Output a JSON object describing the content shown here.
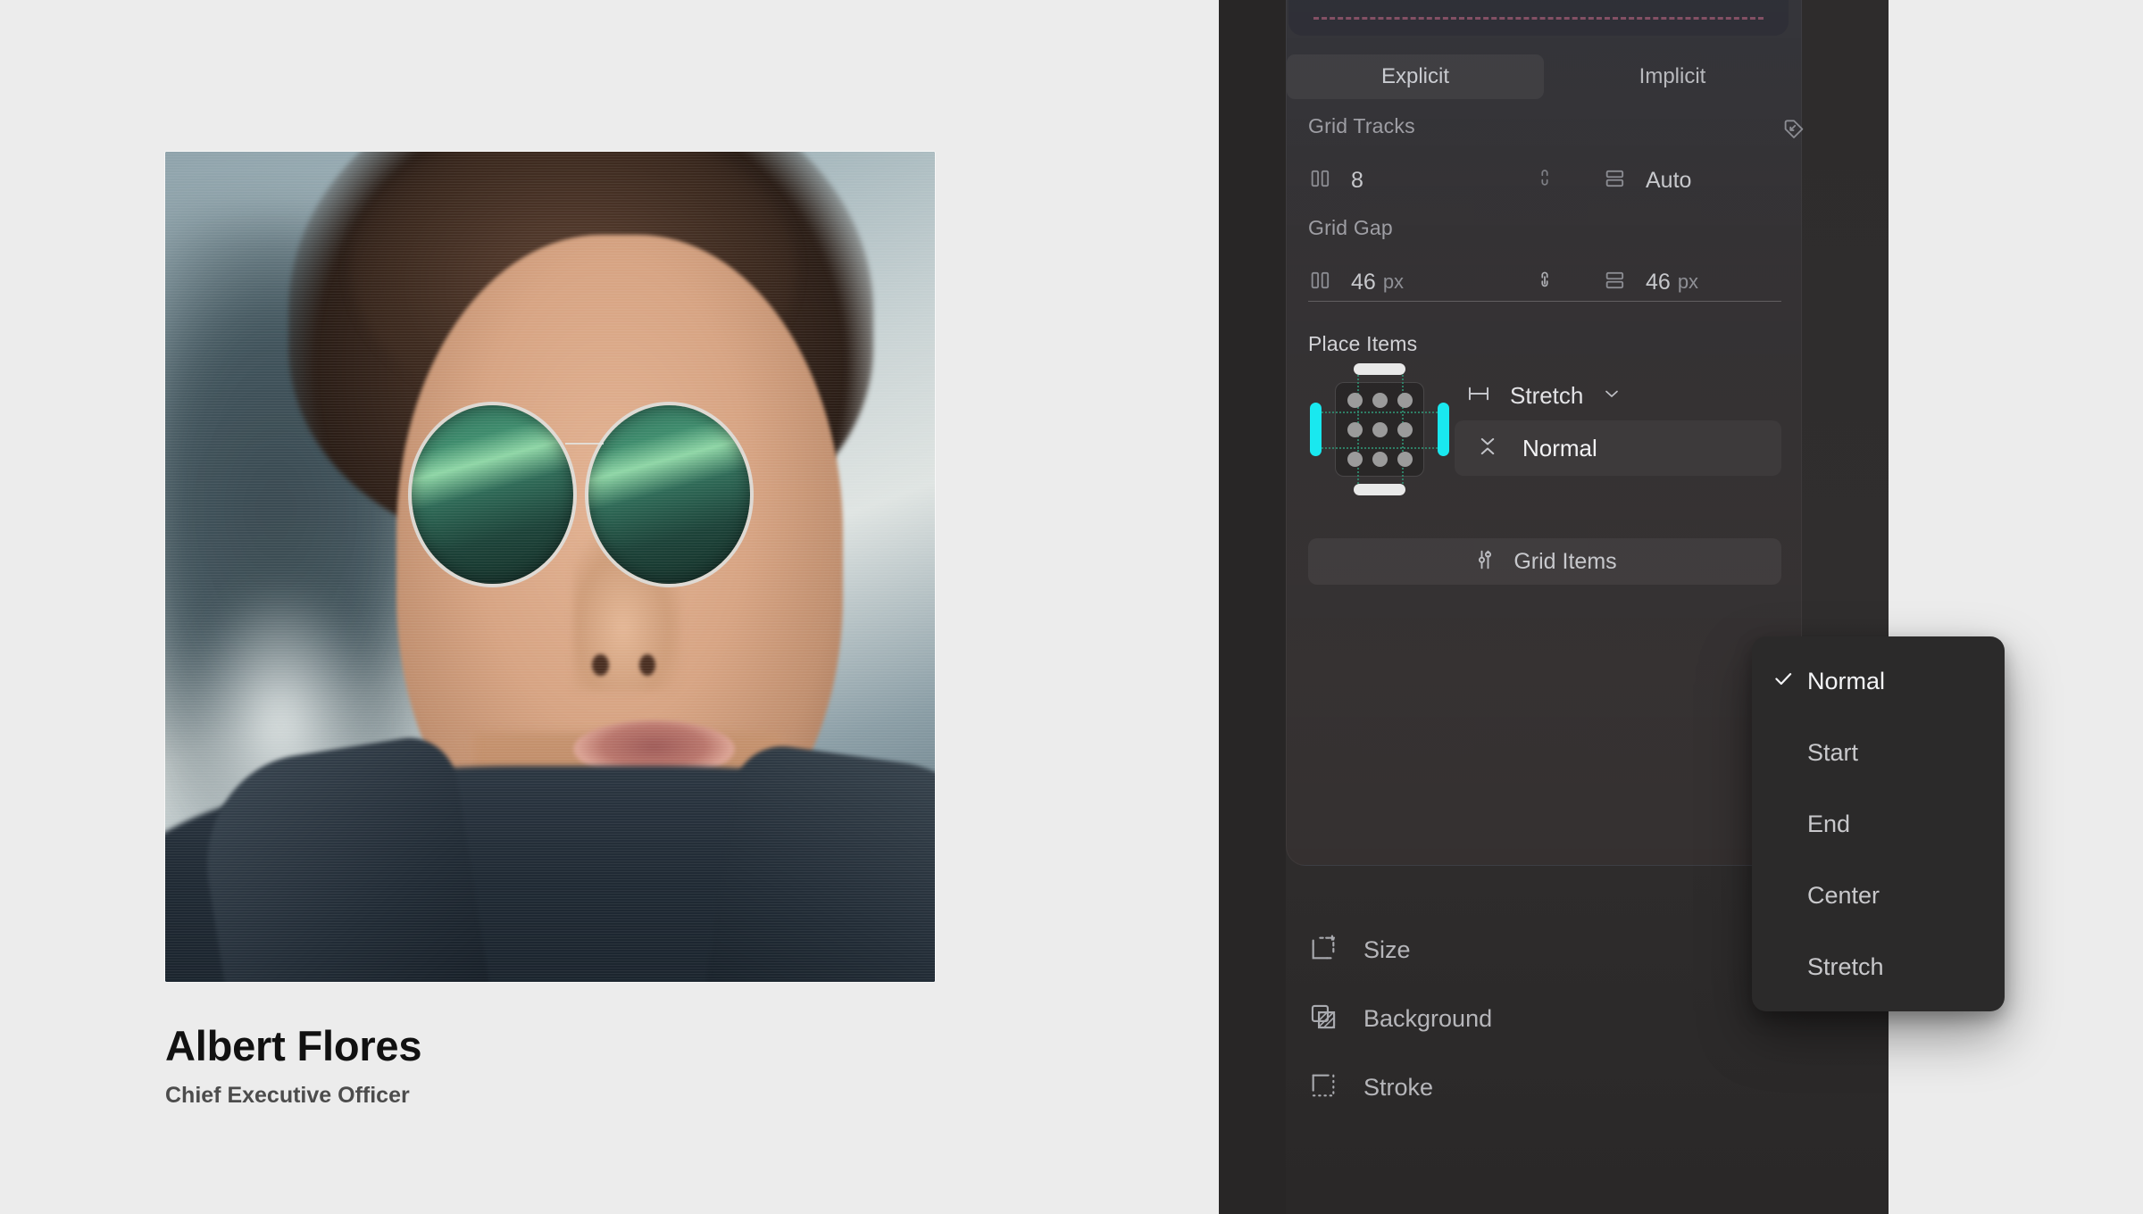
{
  "profile": {
    "name": "Albert Flores",
    "role": "Chief Executive Officer",
    "photo_alt": "portrait-photo"
  },
  "inspector": {
    "segmented": {
      "options": [
        "Explicit",
        "Implicit"
      ],
      "selected": "Explicit"
    },
    "sections": {
      "grid_tracks": {
        "label": "Grid Tracks",
        "columns_value": "8",
        "rows_value": "Auto",
        "link_icon": "link-icon",
        "tag_icon": "tag-arrow-icon"
      },
      "grid_gap": {
        "label": "Grid Gap",
        "column_gap_value": "46",
        "column_gap_unit": "px",
        "row_gap_value": "46",
        "row_gap_unit": "px",
        "link_icon": "link-icon"
      },
      "place_items": {
        "label": "Place Items",
        "justify_value": "Stretch",
        "justify_icon": "horizontal-distribute-icon",
        "align_value": "Normal",
        "align_icon": "vertical-chevrons-icon",
        "chevron_icon": "chevron-down-icon"
      }
    },
    "grid_items_button": {
      "label": "Grid Items",
      "icon": "sliders-icon"
    },
    "bottom_items": [
      {
        "label": "Size",
        "icon": "size-frame-icon"
      },
      {
        "label": "Background",
        "icon": "layers-background-icon"
      },
      {
        "label": "Stroke",
        "icon": "stroke-dashed-icon"
      }
    ]
  },
  "dropdown": {
    "options": [
      "Normal",
      "Start",
      "End",
      "Center",
      "Stretch"
    ],
    "selected": "Normal",
    "check_icon": "check-icon"
  },
  "colors": {
    "accent_cyan": "#19e8ef",
    "guide_green": "#2f7f66",
    "dash_pink": "#c2607d",
    "panel_bg": "#2e2c2c",
    "canvas_bg": "#ececec"
  }
}
